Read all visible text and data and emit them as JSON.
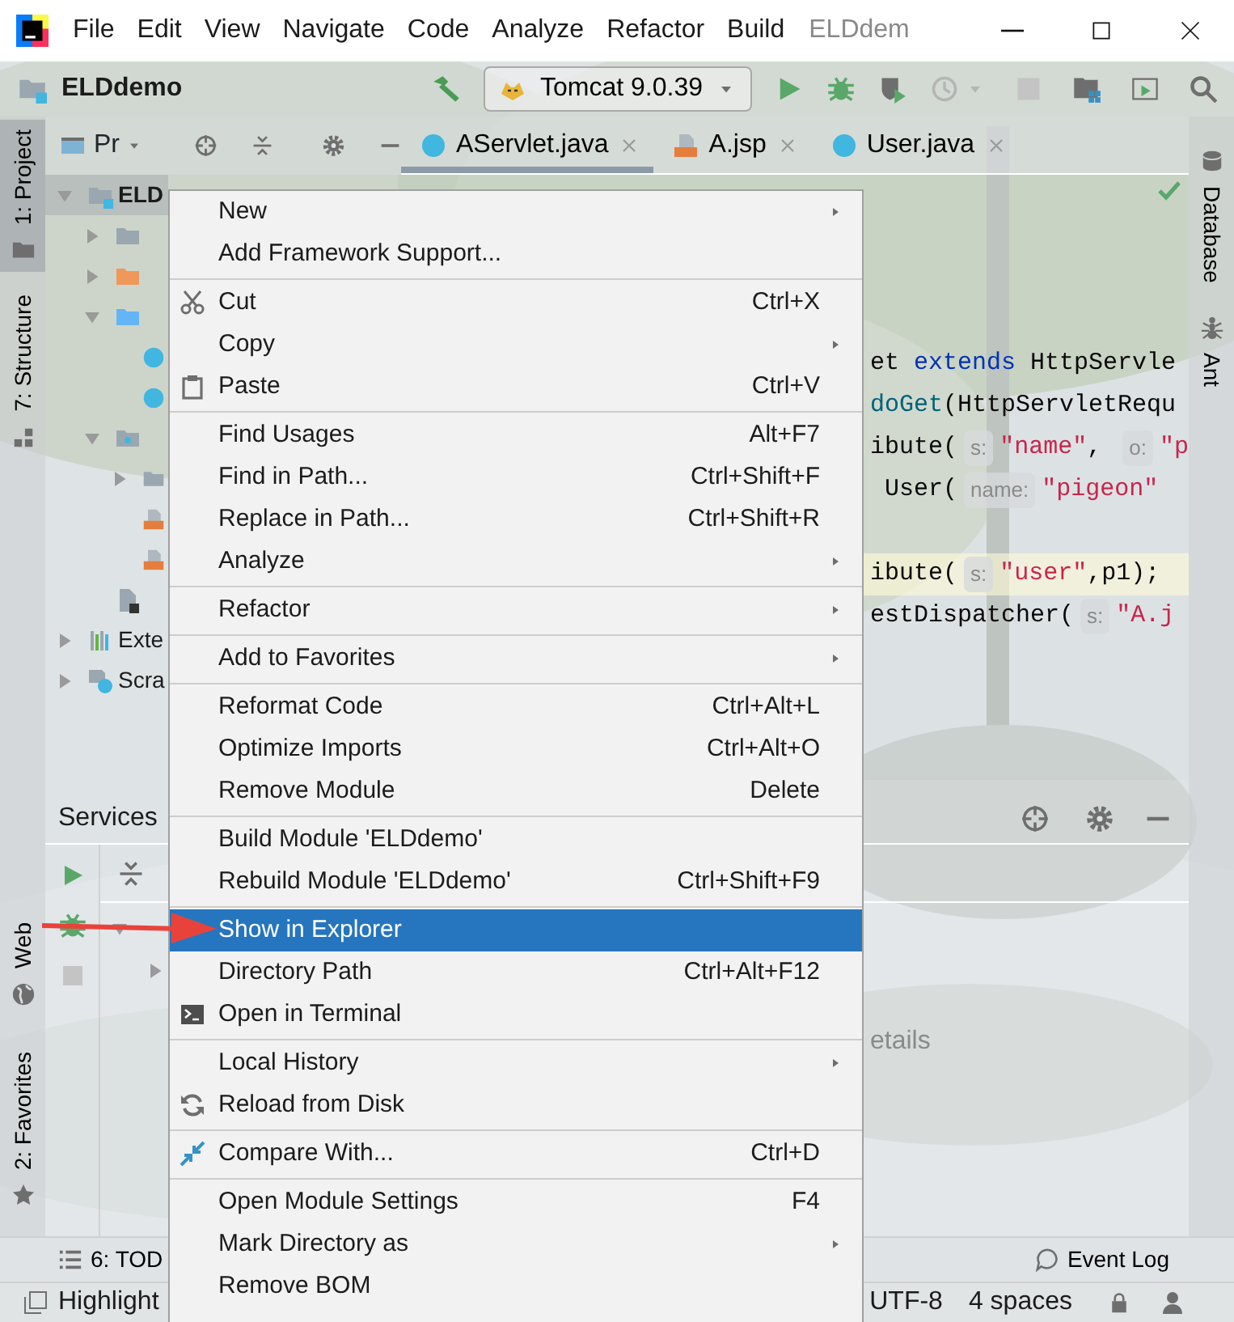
{
  "title_bar": {
    "menu": [
      "File",
      "Edit",
      "View",
      "Navigate",
      "Code",
      "Analyze",
      "Refactor",
      "Build"
    ],
    "title": "ELDdem"
  },
  "toolbar": {
    "project": "ELDdemo",
    "run_configuration": "Tomcat 9.0.39"
  },
  "left_stripe": [
    {
      "label": "1: Project",
      "kind": "project",
      "selected": true
    },
    {
      "label": "7: Structure",
      "kind": "structure",
      "selected": false
    },
    {
      "label": "Web",
      "kind": "web",
      "selected": false
    },
    {
      "label": "2: Favorites",
      "kind": "favorites",
      "selected": false
    }
  ],
  "right_stripe": [
    {
      "label": "Database",
      "kind": "database"
    },
    {
      "label": "Ant",
      "kind": "ant"
    }
  ],
  "project_panel": {
    "view": "Pr",
    "tree": [
      {
        "label": "ELD",
        "kind": "module",
        "expanded": true,
        "selected": true,
        "children": [
          {
            "kind": "folder",
            "expanded": false,
            "selected": false
          },
          {
            "kind": "excluded",
            "expanded": false,
            "selected": false
          },
          {
            "kind": "source",
            "expanded": true,
            "selected": false,
            "children": [
              {
                "kind": "class",
                "selected": false
              },
              {
                "kind": "class",
                "selected": false
              }
            ]
          },
          {
            "kind": "web",
            "expanded": true,
            "selected": false,
            "children": [
              {
                "kind": "folder",
                "expanded": false,
                "selected": false
              },
              {
                "kind": "jsp",
                "selected": false
              },
              {
                "kind": "jsp",
                "selected": false
              }
            ]
          },
          {
            "kind": "module_file",
            "selected": false
          }
        ]
      },
      {
        "label": "Exte",
        "kind": "library",
        "expanded": false,
        "selected": false
      },
      {
        "label": "Scra",
        "kind": "scratch",
        "expanded": false,
        "selected": false
      }
    ]
  },
  "editor_tabs": [
    {
      "label": "AServlet.java",
      "kind": "class",
      "selected": true
    },
    {
      "label": "A.jsp",
      "kind": "jsp",
      "selected": false
    },
    {
      "label": "User.java",
      "kind": "class",
      "selected": false
    }
  ],
  "code_lines": [
    {
      "current": false,
      "segments": [
        {
          "kind": "plain",
          "text": "et "
        },
        {
          "kind": "keyword",
          "text": "extends"
        },
        {
          "kind": "plain",
          "text": " HttpServle"
        }
      ]
    },
    {
      "current": false,
      "segments": [
        {
          "kind": "method",
          "text": "doGet"
        },
        {
          "kind": "plain",
          "text": "(HttpServletRequ"
        }
      ]
    },
    {
      "current": false,
      "segments": [
        {
          "kind": "plain",
          "text": "ibute("
        },
        {
          "kind": "hint",
          "text": "s:"
        },
        {
          "kind": "string",
          "text": "\"name\""
        },
        {
          "kind": "plain",
          "text": ", "
        },
        {
          "kind": "hint",
          "text": "o:"
        },
        {
          "kind": "string",
          "text": "\"p"
        }
      ]
    },
    {
      "current": false,
      "segments": [
        {
          "kind": "plain",
          "text": " User("
        },
        {
          "kind": "hint",
          "text": "name:"
        },
        {
          "kind": "string",
          "text": "\"pigeon\""
        }
      ]
    },
    {
      "current": true,
      "segments": [
        {
          "kind": "plain",
          "text": "ibute("
        },
        {
          "kind": "hint",
          "text": "s:"
        },
        {
          "kind": "string",
          "text": "\"user\""
        },
        {
          "kind": "plain",
          "text": ",p1);"
        }
      ]
    },
    {
      "current": false,
      "segments": [
        {
          "kind": "plain",
          "text": "estDispatcher("
        },
        {
          "kind": "hint",
          "text": "s:"
        },
        {
          "kind": "string",
          "text": "\"A.j"
        }
      ]
    }
  ],
  "services": {
    "title": "Services",
    "hint": "etails"
  },
  "bottom_tools": [
    {
      "label": "6: TOD",
      "kind": "todo"
    },
    {
      "label": "Event Log",
      "kind": "event_log"
    }
  ],
  "status_bar": {
    "message": "Highlight",
    "encoding": "UTF-8",
    "indent": "4 spaces"
  },
  "context_menu": {
    "groups": [
      [
        {
          "label": "New",
          "submenu": true,
          "selected": false,
          "kind": "plain"
        },
        {
          "label": "Add Framework Support...",
          "submenu": false,
          "selected": false,
          "kind": "plain"
        }
      ],
      [
        {
          "label": "Cut",
          "shortcut": "Ctrl+X",
          "submenu": false,
          "selected": false,
          "kind": "cut"
        },
        {
          "label": "Copy",
          "submenu": true,
          "selected": false,
          "kind": "plain"
        },
        {
          "label": "Paste",
          "shortcut": "Ctrl+V",
          "submenu": false,
          "selected": false,
          "kind": "paste"
        }
      ],
      [
        {
          "label": "Find Usages",
          "shortcut": "Alt+F7",
          "submenu": false,
          "selected": false,
          "kind": "plain"
        },
        {
          "label": "Find in Path...",
          "shortcut": "Ctrl+Shift+F",
          "submenu": false,
          "selected": false,
          "kind": "plain"
        },
        {
          "label": "Replace in Path...",
          "shortcut": "Ctrl+Shift+R",
          "submenu": false,
          "selected": false,
          "kind": "plain"
        },
        {
          "label": "Analyze",
          "submenu": true,
          "selected": false,
          "kind": "plain"
        }
      ],
      [
        {
          "label": "Refactor",
          "submenu": true,
          "selected": false,
          "kind": "plain"
        }
      ],
      [
        {
          "label": "Add to Favorites",
          "submenu": true,
          "selected": false,
          "kind": "plain"
        }
      ],
      [
        {
          "label": "Reformat Code",
          "shortcut": "Ctrl+Alt+L",
          "submenu": false,
          "selected": false,
          "kind": "plain"
        },
        {
          "label": "Optimize Imports",
          "shortcut": "Ctrl+Alt+O",
          "submenu": false,
          "selected": false,
          "kind": "plain"
        },
        {
          "label": "Remove Module",
          "shortcut": "Delete",
          "submenu": false,
          "selected": false,
          "kind": "plain"
        }
      ],
      [
        {
          "label": "Build Module 'ELDdemo'",
          "submenu": false,
          "selected": false,
          "kind": "plain"
        },
        {
          "label": "Rebuild Module 'ELDdemo'",
          "shortcut": "Ctrl+Shift+F9",
          "submenu": false,
          "selected": false,
          "kind": "plain"
        }
      ],
      [
        {
          "label": "Show in Explorer",
          "submenu": false,
          "selected": true,
          "kind": "plain"
        },
        {
          "label": "Directory Path",
          "shortcut": "Ctrl+Alt+F12",
          "submenu": false,
          "selected": false,
          "kind": "plain"
        },
        {
          "label": "Open in Terminal",
          "submenu": false,
          "selected": false,
          "kind": "terminal"
        }
      ],
      [
        {
          "label": "Local History",
          "submenu": true,
          "selected": false,
          "kind": "plain"
        },
        {
          "label": "Reload from Disk",
          "submenu": false,
          "selected": false,
          "kind": "reload"
        }
      ],
      [
        {
          "label": "Compare With...",
          "shortcut": "Ctrl+D",
          "submenu": false,
          "selected": false,
          "kind": "compare"
        }
      ],
      [
        {
          "label": "Open Module Settings",
          "shortcut": "F4",
          "submenu": false,
          "selected": false,
          "kind": "plain"
        },
        {
          "label": "Mark Directory as",
          "submenu": true,
          "selected": false,
          "kind": "plain"
        },
        {
          "label": "Remove BOM",
          "submenu": false,
          "selected": false,
          "kind": "plain"
        }
      ]
    ]
  },
  "annotation": {
    "kind": "arrow"
  }
}
